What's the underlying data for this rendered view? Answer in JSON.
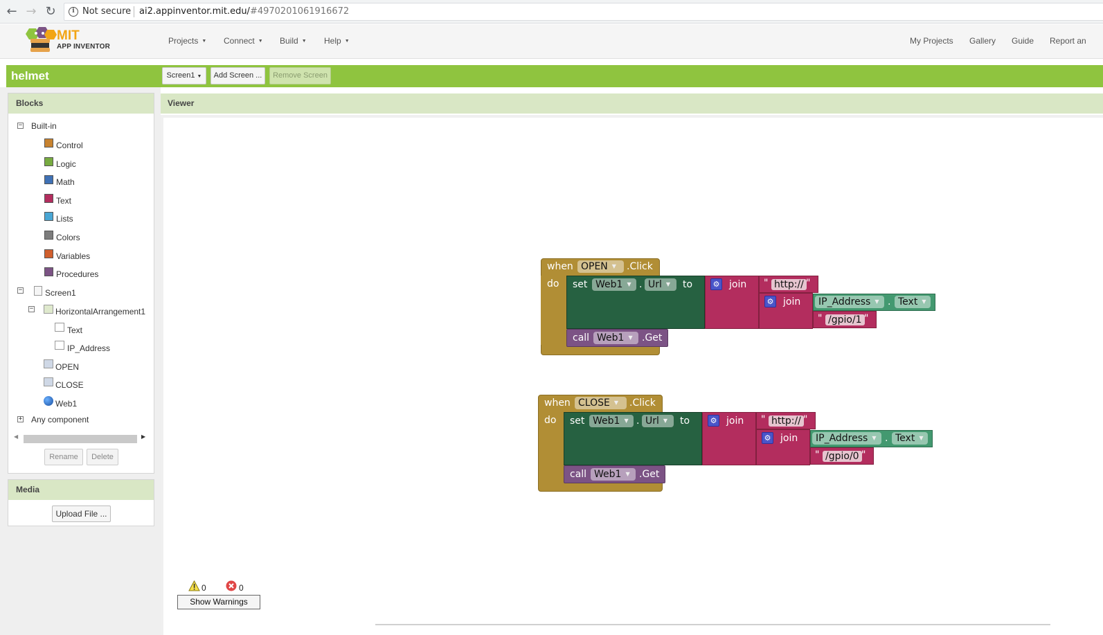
{
  "browser": {
    "security_label": "Not secure",
    "url_host": "ai2.appinventor.mit.edu/",
    "url_hash": "#4970201061916672"
  },
  "header": {
    "logo_top": "MIT",
    "logo_bottom": "APP INVENTOR",
    "menus": [
      "Projects",
      "Connect",
      "Build",
      "Help"
    ],
    "links": [
      "My Projects",
      "Gallery",
      "Guide",
      "Report an"
    ]
  },
  "project": {
    "name": "helmet",
    "screen_select": "Screen1",
    "add_screen": "Add Screen ...",
    "remove_screen": "Remove Screen"
  },
  "blocks_panel": {
    "title": "Blocks",
    "builtin_label": "Built-in",
    "builtin": [
      {
        "label": "Control",
        "color": "#c88330"
      },
      {
        "label": "Logic",
        "color": "#77ab41"
      },
      {
        "label": "Math",
        "color": "#3f71b5"
      },
      {
        "label": "Text",
        "color": "#b32d5e"
      },
      {
        "label": "Lists",
        "color": "#49a6d4"
      },
      {
        "label": "Colors",
        "color": "#7d7d7d"
      },
      {
        "label": "Variables",
        "color": "#d05f2d"
      },
      {
        "label": "Procedures",
        "color": "#7c5385"
      }
    ],
    "screen_label": "Screen1",
    "arrangement_label": "HorizontalArrangement1",
    "text_label": "Text",
    "ip_label": "IP_Address",
    "open_label": "OPEN",
    "close_label": "CLOSE",
    "web_label": "Web1",
    "any_component": "Any component",
    "rename": "Rename",
    "delete": "Delete"
  },
  "media_panel": {
    "title": "Media",
    "upload": "Upload File ..."
  },
  "viewer": {
    "title": "Viewer",
    "warnings_count": "0",
    "errors_count": "0",
    "show_warnings": "Show Warnings"
  },
  "block_open": {
    "when": "when",
    "component": "OPEN",
    "event": ".Click",
    "do": "do",
    "set": "set",
    "set_component": "Web1",
    "dot": ".",
    "property": "Url",
    "to": "to",
    "join": "join",
    "str_http": "http://",
    "inner_join": "join",
    "text_component": "IP_Address",
    "text_property": "Text",
    "str_gpio": "/gpio/1",
    "call": "call",
    "call_component": "Web1",
    "method": ".Get"
  },
  "block_close": {
    "when": "when",
    "component": "CLOSE",
    "event": ".Click",
    "do": "do",
    "set": "set",
    "set_component": "Web1",
    "dot": ".",
    "property": "Url",
    "to": "to",
    "join": "join",
    "str_http": "http://",
    "inner_join": "join",
    "text_component": "IP_Address",
    "text_property": "Text",
    "str_gpio": "/gpio/0",
    "call": "call",
    "call_component": "Web1",
    "method": ".Get"
  },
  "quote": "\""
}
